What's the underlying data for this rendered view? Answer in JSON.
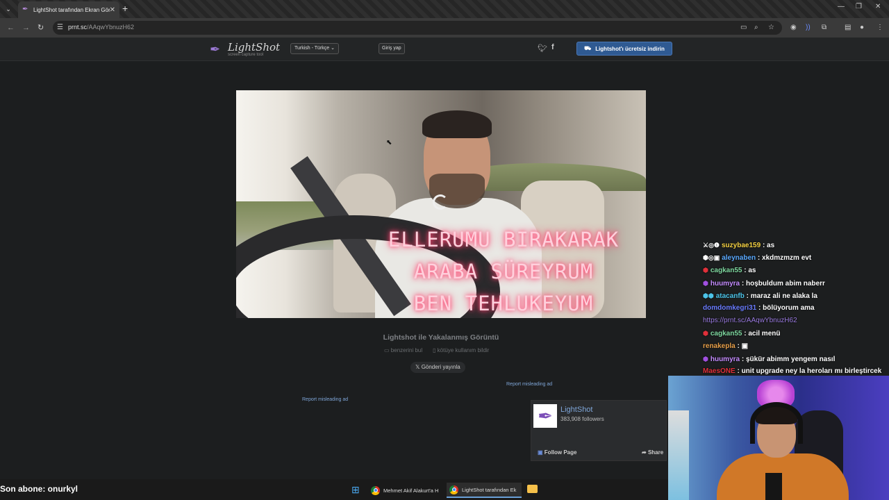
{
  "browser": {
    "tab_title": "LightShot tarafından Ekran Görü",
    "url_host": "prnt.sc",
    "url_path": "/AAqwYbnuzH62",
    "new_tab": "+",
    "tab_close": "✕"
  },
  "header": {
    "logo_name": "LightShot",
    "logo_tagline": "screen capture tool",
    "language": "Turkish - Türkçe",
    "login": "Giriş yap",
    "download": "Lightshot'ı ücretsiz indirin"
  },
  "screenshot": {
    "caption_lines": [
      "ELLERUMU BIRAKARAK",
      "ARABA SÜREYRUM",
      "BEN TEHLUKEYUM"
    ]
  },
  "below": {
    "title": "Lightshot ile Yakalanmış Görüntü",
    "similar": "benzerini bul",
    "report_abuse": "kötüye kullanım bildir",
    "post_tweet": "Gönderi yayınla",
    "report_ad_right": "Report misleading ad",
    "report_ad_left": "Report misleading ad"
  },
  "fb_widget": {
    "page_name": "LightShot",
    "followers": "383,908 followers",
    "follow": "Follow Page",
    "share": "Share"
  },
  "chat": [
    {
      "badges": "⚔◎❶",
      "user": "suzybae159",
      "color": "#f5d142",
      "message": ": as"
    },
    {
      "badges": "⬢◎▣",
      "user": "aleynaben",
      "color": "#5aa9ff",
      "message": ": xkdmzmzm evt"
    },
    {
      "badges": "⬢",
      "user": "cagkan55",
      "color": "#7fd8a0",
      "message": ": as"
    },
    {
      "badges": "⬢",
      "user": "huumyra",
      "color": "#c48cff",
      "message": ": hoşbuldum abim naberr"
    },
    {
      "badges": "⬢⬢",
      "user": "atacanfb",
      "color": "#4cc3e8",
      "message": ": maraz ali ne alaka la"
    },
    {
      "badges": "",
      "user": "domdomkegri31",
      "color": "#6a7cff",
      "message": ": bölüyorum ama"
    },
    {
      "badges": "",
      "user": "",
      "color": "#9a7be0",
      "message": "https://prnt.sc/AAqwYbnuzH62"
    },
    {
      "badges": "⬢",
      "user": "cagkan55",
      "color": "#7fd8a0",
      "message": ": acil menü"
    },
    {
      "badges": "",
      "user": "renakepla",
      "color": "#e8a04a",
      "message": ": ▣"
    },
    {
      "badges": "⬢",
      "user": "huumyra",
      "color": "#c48cff",
      "message": ": şükür abimm yengem nasıl"
    },
    {
      "badges": "",
      "user": "MaesONE",
      "color": "#e0303a",
      "message": ": unit upgrade ney la heroları mı birleştircek"
    }
  ],
  "overlay": {
    "last_sub": "Son abone: onurkyl"
  },
  "taskbar": {
    "item1": "Mehmet Akif Alakurt'a H",
    "item2": "LightShot tarafından Ek"
  }
}
